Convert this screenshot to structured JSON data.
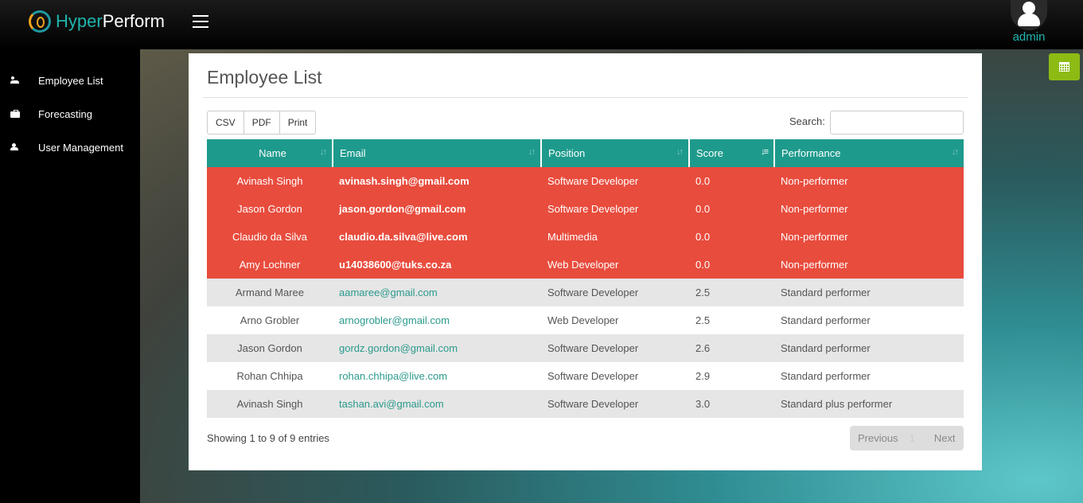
{
  "header": {
    "brand_hyper": "Hyper",
    "brand_perform": "Perform",
    "user_name": "admin"
  },
  "sidebar": {
    "items": [
      {
        "label": "Employee List",
        "icon": "users-icon"
      },
      {
        "label": "Forecasting",
        "icon": "briefcase-icon"
      },
      {
        "label": "User Management",
        "icon": "user-icon"
      }
    ]
  },
  "panel": {
    "title": "Employee List",
    "buttons": {
      "csv": "CSV",
      "pdf": "PDF",
      "print": "Print"
    },
    "search_label": "Search:",
    "search_value": ""
  },
  "table": {
    "columns": [
      "Name",
      "Email",
      "Position",
      "Score",
      "Performance"
    ],
    "rows": [
      {
        "name": "Avinash Singh",
        "email": "avinash.singh@gmail.com",
        "position": "Software Developer",
        "score": "0.0",
        "performance": "Non-performer"
      },
      {
        "name": "Jason Gordon",
        "email": "jason.gordon@gmail.com",
        "position": "Software Developer",
        "score": "0.0",
        "performance": "Non-performer"
      },
      {
        "name": "Claudio da Silva",
        "email": "claudio.da.silva@live.com",
        "position": "Multimedia",
        "score": "0.0",
        "performance": "Non-performer"
      },
      {
        "name": "Amy Lochner",
        "email": "u14038600@tuks.co.za",
        "position": "Web Developer",
        "score": "0.0",
        "performance": "Non-performer"
      },
      {
        "name": "Armand Maree",
        "email": "aamaree@gmail.com",
        "position": "Software Developer",
        "score": "2.5",
        "performance": "Standard performer"
      },
      {
        "name": "Arno Grobler",
        "email": "arnogrobler@gmail.com",
        "position": "Web Developer",
        "score": "2.5",
        "performance": "Standard performer"
      },
      {
        "name": "Jason Gordon",
        "email": "gordz.gordon@gmail.com",
        "position": "Software Developer",
        "score": "2.6",
        "performance": "Standard performer"
      },
      {
        "name": "Rohan Chhipa",
        "email": "rohan.chhipa@live.com",
        "position": "Software Developer",
        "score": "2.9",
        "performance": "Standard performer"
      },
      {
        "name": "Avinash Singh",
        "email": "tashan.avi@gmail.com",
        "position": "Software Developer",
        "score": "3.0",
        "performance": "Standard plus performer"
      }
    ]
  },
  "footer": {
    "info": "Showing 1 to 9 of 9 entries",
    "previous": "Previous",
    "page": "1",
    "next": "Next"
  },
  "colors": {
    "accent": "#1e9a8c",
    "danger": "#e84c3d",
    "calendar_button": "#8dbb14"
  }
}
